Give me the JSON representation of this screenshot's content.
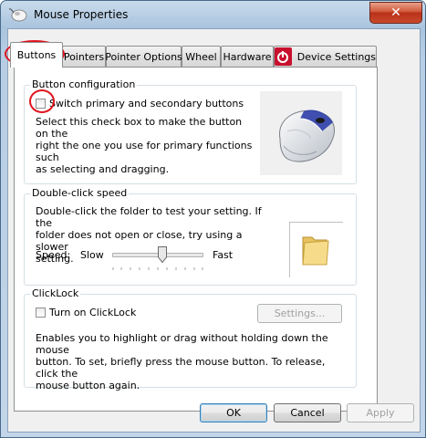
{
  "window": {
    "title": "Mouse Properties",
    "close_glyph": "✕"
  },
  "tabs": [
    {
      "label": "Buttons"
    },
    {
      "label": "Pointers"
    },
    {
      "label": "Pointer Options"
    },
    {
      "label": "Wheel"
    },
    {
      "label": "Hardware"
    },
    {
      "label": "Device Settings"
    }
  ],
  "button_configuration": {
    "group_label": "Button configuration",
    "checkbox_label": "Switch primary and secondary buttons",
    "description_lines": [
      "Select this check box to make the button on the",
      "right the one you use for primary functions such",
      "as selecting and dragging."
    ]
  },
  "double_click": {
    "group_label": "Double-click speed",
    "description_lines": [
      "Double-click the folder to test your setting. If the",
      "folder does not open or close, try using a slower",
      "setting."
    ],
    "speed_label": "Speed:",
    "slow_label": "Slow",
    "fast_label": "Fast",
    "slider_fraction": 0.55
  },
  "clicklock": {
    "group_label": "ClickLock",
    "checkbox_label": "Turn on ClickLock",
    "settings_button": "Settings...",
    "description_lines": [
      "Enables you to highlight or drag without holding down the mouse",
      "button. To set, briefly press the mouse button. To release, click the",
      "mouse button again."
    ]
  },
  "footer": {
    "ok": "OK",
    "cancel": "Cancel",
    "apply": "Apply"
  },
  "colors": {
    "accent": "#3a5fcd",
    "annotation": "#e0141e",
    "brand": "#c8102e"
  }
}
